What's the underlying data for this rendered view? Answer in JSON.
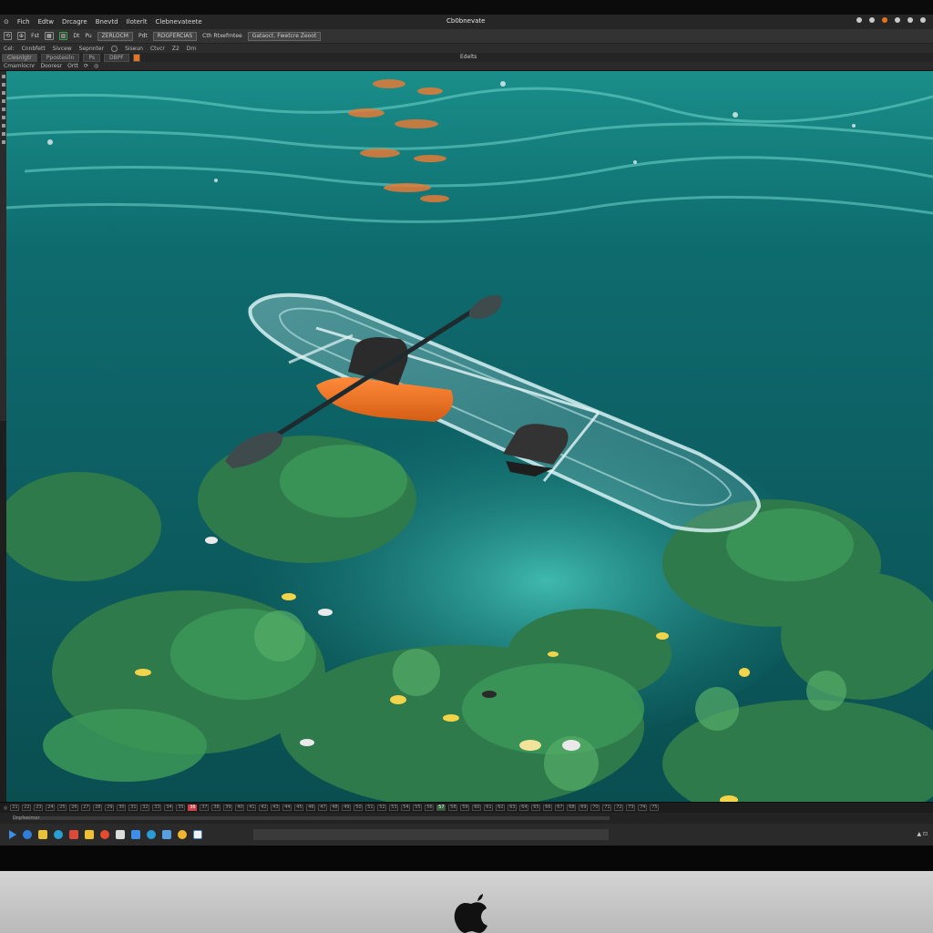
{
  "app": {
    "document_title": "Cb0bnevate",
    "menu": [
      "Fich",
      "Edtw",
      "Drcagre",
      "Bnevtd",
      "Iloterlt",
      "Clebnevateete"
    ]
  },
  "toolbar": {
    "items": [
      "⟲",
      "⊕",
      "Fst",
      "▦",
      "▧",
      "Dt",
      "Pu",
      "ZERLOCM",
      "Pdt",
      "RDGFERCIAS",
      "Cth Rtxefmtee",
      "Gataoct. Fwetcre Zeoot"
    ]
  },
  "optbar": {
    "items": [
      "Cel:",
      "Cnnbfett",
      "Sivcew",
      "Sepnnter",
      "Siseun",
      "Ctvcr",
      "Z2",
      "Drn"
    ]
  },
  "tabs": {
    "items": [
      "Clesnlgtr",
      "Ppostesiln",
      "Ps",
      "DBPF"
    ],
    "center_label": "Edelts"
  },
  "panelbar": {
    "items": [
      "Cmamlocnr",
      "Dooresr",
      "Ortt"
    ]
  },
  "timeline": {
    "frames": [
      "21",
      "22",
      "23",
      "24",
      "25",
      "26",
      "27",
      "28",
      "29",
      "30",
      "31",
      "32",
      "33",
      "34",
      "35",
      "36",
      "37",
      "38",
      "39",
      "40",
      "41",
      "42",
      "43",
      "44",
      "45",
      "46",
      "47",
      "48",
      "49",
      "50",
      "51",
      "52",
      "53",
      "54",
      "55",
      "56",
      "57",
      "58",
      "59",
      "60",
      "61",
      "62",
      "63",
      "64",
      "65",
      "66",
      "67",
      "68",
      "69",
      "70",
      "71",
      "72",
      "73",
      "74",
      "75"
    ],
    "active_frame": "36",
    "marker_frame": "57"
  },
  "tracklabel": "Dnpfeeimer",
  "colors": {
    "accent_orange": "#e8731c",
    "water_deep": "#0d5a5c",
    "water_light": "#1fa6a4",
    "coral_green": "#2e7a4a"
  },
  "icons": {
    "app_logo": "apple-icon"
  }
}
